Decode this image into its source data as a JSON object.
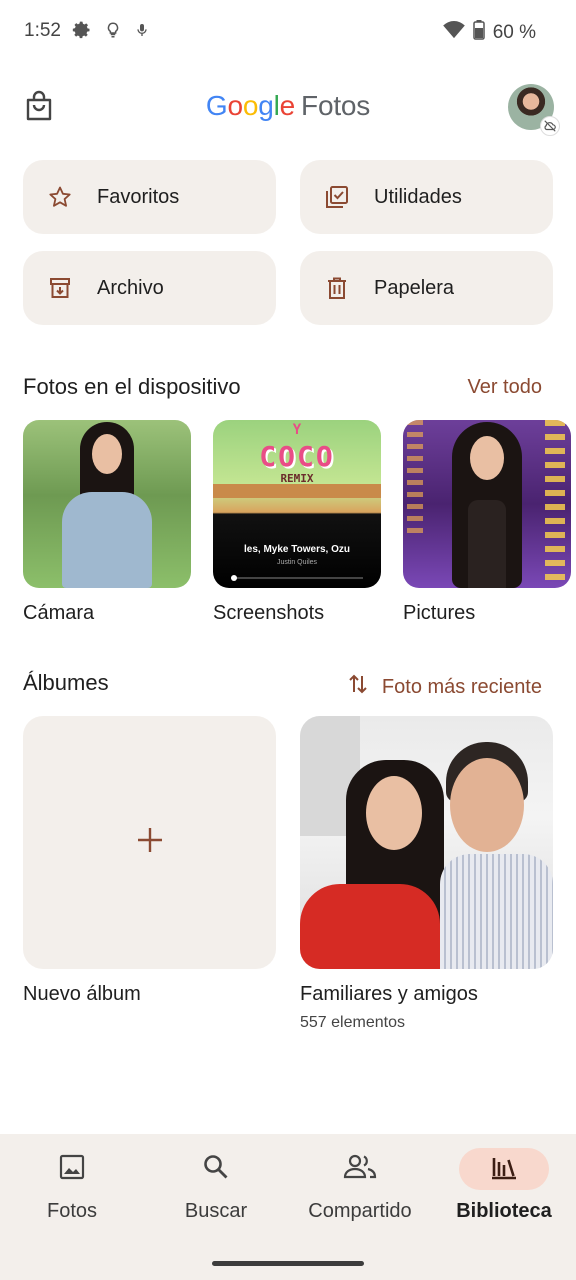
{
  "status": {
    "time": "1:52",
    "battery": "60 %",
    "icons": [
      "gear-icon",
      "lightbulb-icon",
      "mic-icon",
      "wifi-icon",
      "battery-icon"
    ]
  },
  "header": {
    "logo_letters": [
      "G",
      "o",
      "o",
      "g",
      "l",
      "e"
    ],
    "logo_suffix": "Fotos"
  },
  "quick_actions": [
    {
      "label": "Favoritos",
      "icon": "star-icon"
    },
    {
      "label": "Utilidades",
      "icon": "utilities-icon"
    },
    {
      "label": "Archivo",
      "icon": "archive-icon"
    },
    {
      "label": "Papelera",
      "icon": "trash-icon"
    }
  ],
  "device_section": {
    "title": "Fotos en el dispositivo",
    "action": "Ver todo",
    "folders": [
      {
        "label": "Cámara"
      },
      {
        "label": "Screenshots",
        "overlay_title": "COCO",
        "overlay_top": "Y",
        "overlay_sub": "REMIX",
        "overlay_song": "les, Myke Towers, Ozu",
        "overlay_artist": "Justin Quiles"
      },
      {
        "label": "Pictures"
      }
    ]
  },
  "albums_section": {
    "title": "Álbumes",
    "sort_label": "Foto más reciente",
    "albums": [
      {
        "title": "Nuevo álbum",
        "count": ""
      },
      {
        "title": "Familiares y amigos",
        "count": "557 elementos"
      }
    ]
  },
  "bottom_nav": {
    "items": [
      {
        "label": "Fotos",
        "icon": "photo-icon",
        "active": false
      },
      {
        "label": "Buscar",
        "icon": "search-icon",
        "active": false
      },
      {
        "label": "Compartido",
        "icon": "people-icon",
        "active": false
      },
      {
        "label": "Biblioteca",
        "icon": "library-icon",
        "active": true
      }
    ]
  },
  "colors": {
    "accent": "#8b4a32",
    "card_bg": "#f3efeb",
    "nav_active_pill": "#f8d8cd"
  }
}
